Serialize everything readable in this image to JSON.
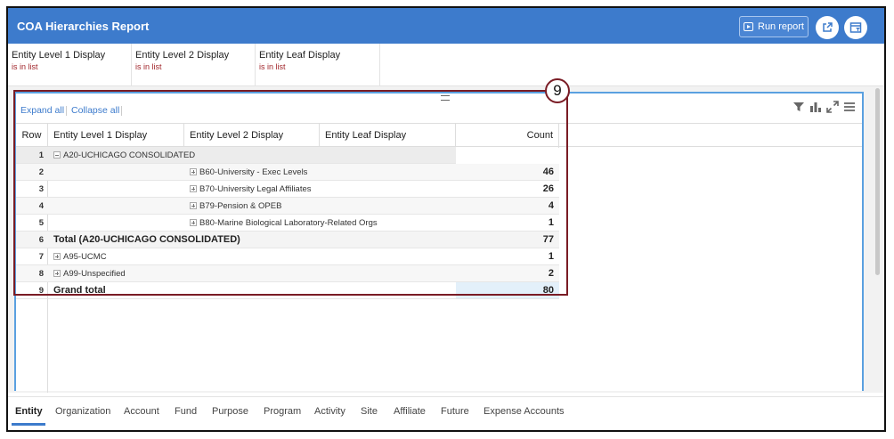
{
  "header": {
    "title": "COA Hierarchies Report",
    "run_label": "Run report"
  },
  "filters": [
    {
      "label": "Entity Level 1 Display",
      "value": "is in list"
    },
    {
      "label": "Entity Level 2 Display",
      "value": "is in list"
    },
    {
      "label": "Entity Leaf Display",
      "value": "is in list"
    }
  ],
  "toolbar": {
    "expand_all": "Expand all",
    "collapse_all": "Collapse all"
  },
  "table": {
    "columns": [
      "Row",
      "Entity Level 1 Display",
      "Entity Level 2 Display",
      "Entity Leaf Display",
      "Count"
    ],
    "rows": [
      {
        "row": "1",
        "l1": "A20-UCHICAGO CONSOLIDATED",
        "l2": "",
        "count": ""
      },
      {
        "row": "2",
        "l1": "",
        "l2": "B60-University - Exec Levels",
        "count": "46"
      },
      {
        "row": "3",
        "l1": "",
        "l2": "B70-University Legal Affiliates",
        "count": "26"
      },
      {
        "row": "4",
        "l1": "",
        "l2": "B79-Pension & OPEB",
        "count": "4"
      },
      {
        "row": "5",
        "l1": "",
        "l2": "B80-Marine Biological Laboratory-Related Orgs",
        "count": "1"
      },
      {
        "row": "6",
        "l1": "Total (A20-UCHICAGO CONSOLIDATED)",
        "l2": "",
        "count": "77"
      },
      {
        "row": "7",
        "l1": "A95-UCMC",
        "l2": "",
        "count": "1"
      },
      {
        "row": "8",
        "l1": "A99-Unspecified",
        "l2": "",
        "count": "2"
      },
      {
        "row": "9",
        "l1": "Grand total",
        "l2": "",
        "count": "80"
      }
    ]
  },
  "callout_number": "9",
  "tabs": [
    "Entity",
    "Organization",
    "Account",
    "Fund",
    "Purpose",
    "Program",
    "Activity",
    "Site",
    "Affiliate",
    "Future",
    "Expense Accounts"
  ],
  "active_tab": "Entity",
  "colors": {
    "header": "#3d7bcc",
    "callout": "#7a1c25",
    "filter_value": "#a1262b"
  }
}
